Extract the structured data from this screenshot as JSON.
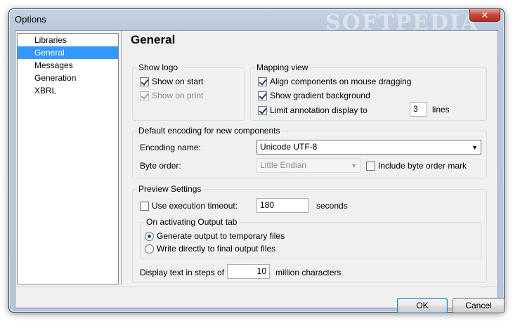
{
  "window": {
    "title": "Options",
    "watermark": "SOFTPEDIA",
    "close_label": "✕"
  },
  "sidebar": {
    "items": [
      {
        "label": "Libraries",
        "selected": false
      },
      {
        "label": "General",
        "selected": true
      },
      {
        "label": "Messages",
        "selected": false
      },
      {
        "label": "Generation",
        "selected": false
      },
      {
        "label": "XBRL",
        "selected": false
      }
    ]
  },
  "page": {
    "heading": "General"
  },
  "show_logo": {
    "legend": "Show logo",
    "show_on_start": {
      "label": "Show on start",
      "checked": true
    },
    "show_on_print": {
      "label": "Show on print",
      "checked": true,
      "enabled": false
    }
  },
  "mapping_view": {
    "legend": "Mapping view",
    "align_components": {
      "label": "Align components on mouse dragging",
      "checked": true
    },
    "gradient_background": {
      "label": "Show gradient background",
      "checked": true
    },
    "limit_annotation": {
      "label": "Limit annotation display to",
      "checked": true,
      "value": "3",
      "suffix": "lines"
    }
  },
  "encoding": {
    "legend": "Default encoding for new components",
    "name_label": "Encoding name:",
    "name_value": "Unicode UTF-8",
    "byte_order_label": "Byte order:",
    "byte_order_value": "Little Endian",
    "include_bom": {
      "label": "Include byte order mark",
      "checked": false
    }
  },
  "preview": {
    "legend": "Preview Settings",
    "execution_timeout": {
      "label": "Use execution timeout:",
      "checked": false,
      "value": "180",
      "suffix": "seconds"
    },
    "output_tab": {
      "legend": "On activating Output tab",
      "options": [
        {
          "label": "Generate output to temporary files",
          "selected": true
        },
        {
          "label": "Write directly to final output files",
          "selected": false
        }
      ]
    },
    "display_steps": {
      "label": "Display text in steps of",
      "value": "10",
      "suffix": "million characters"
    }
  },
  "buttons": {
    "ok": "OK",
    "cancel": "Cancel"
  }
}
